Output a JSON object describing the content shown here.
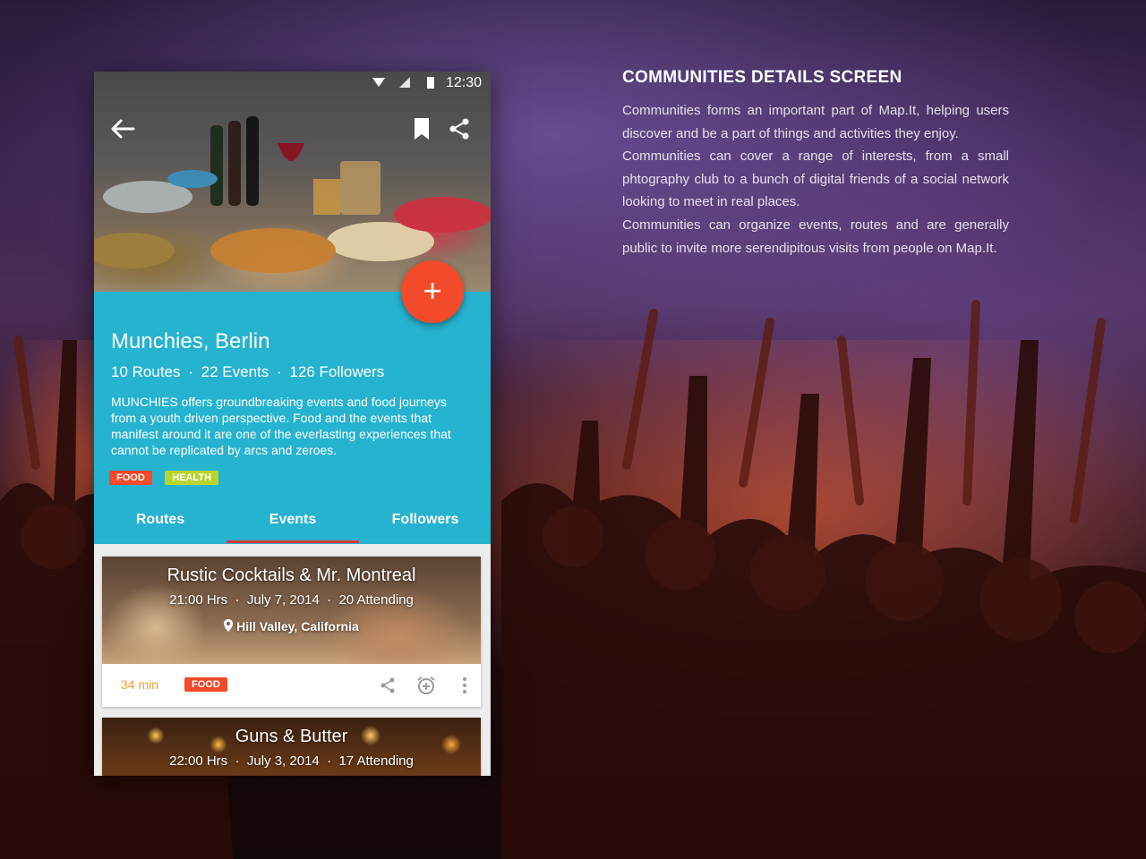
{
  "statusbar": {
    "time": "12:30"
  },
  "community": {
    "title": "Munchies, Berlin",
    "routes": "10 Routes",
    "events": "22 Events",
    "followers": "126 Followers",
    "separator": "·",
    "description": "MUNCHIES offers groundbreaking events and food journeys from a youth driven perspective. Food and the events that manifest around it are one of the everlasting experiences that cannot be replicated by arcs and zeroes.",
    "tags": [
      {
        "label": "FOOD",
        "color": "#f24a2b"
      },
      {
        "label": "HEALTH",
        "color": "#b8d430"
      }
    ]
  },
  "tabs": [
    {
      "label": "Routes"
    },
    {
      "label": "Events"
    },
    {
      "label": "Followers"
    }
  ],
  "active_tab": "Events",
  "fab": {
    "label": "+"
  },
  "events": [
    {
      "title": "Rustic Cocktails & Mr. Montreal",
      "time": "21:00 Hrs",
      "date": "July 7, 2014",
      "attending": "20 Attending",
      "location": "Hill Valley, California",
      "duration": "34 min",
      "tag": "FOOD"
    },
    {
      "title": "Guns & Butter",
      "time": "22:00 Hrs",
      "date": "July 3, 2014",
      "attending": "17 Attending"
    }
  ],
  "side": {
    "heading": "COMMUNITIES DETAILS SCREEN",
    "p1": "Communities forms an important part of Map.It, helping users discover and be a part of things and activities they enjoy.",
    "p2": "Communities can cover a range of interests, from a small phtography club to a bunch of digital friends of a social network looking to meet in real places.",
    "p3": "Communities can organize events, routes and are generally public to invite more serendipitous visits from people on Map.It."
  },
  "colors": {
    "accent": "#26b3cf",
    "fab": "#f24a2b",
    "tab_indicator": "#d83a3a",
    "duration": "#f0a030"
  }
}
